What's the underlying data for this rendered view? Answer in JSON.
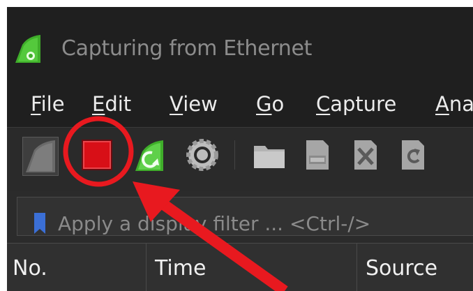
{
  "window": {
    "title": "Capturing from Ethernet"
  },
  "menu": [
    {
      "mnemonic": "F",
      "rest": "ile"
    },
    {
      "mnemonic": "E",
      "rest": "dit"
    },
    {
      "mnemonic": "V",
      "rest": "iew"
    },
    {
      "mnemonic": "G",
      "rest": "o"
    },
    {
      "mnemonic": "C",
      "rest": "apture"
    },
    {
      "mnemonic": "A",
      "rest": "na"
    }
  ],
  "toolbar": {
    "icons": [
      "start-capture-icon",
      "stop-capture-icon",
      "restart-capture-icon",
      "capture-options-icon",
      "open-file-icon",
      "save-file-icon",
      "close-file-icon",
      "reload-file-icon"
    ]
  },
  "filter": {
    "placeholder": "Apply a display filter ... <Ctrl-/>"
  },
  "columns": {
    "no": "No.",
    "time": "Time",
    "source": "Source"
  },
  "colors": {
    "accent_red": "#e8191f",
    "stop_red": "#d80f17",
    "bookmark_blue": "#3b6fd6",
    "shark_green": "#3fae2a"
  }
}
